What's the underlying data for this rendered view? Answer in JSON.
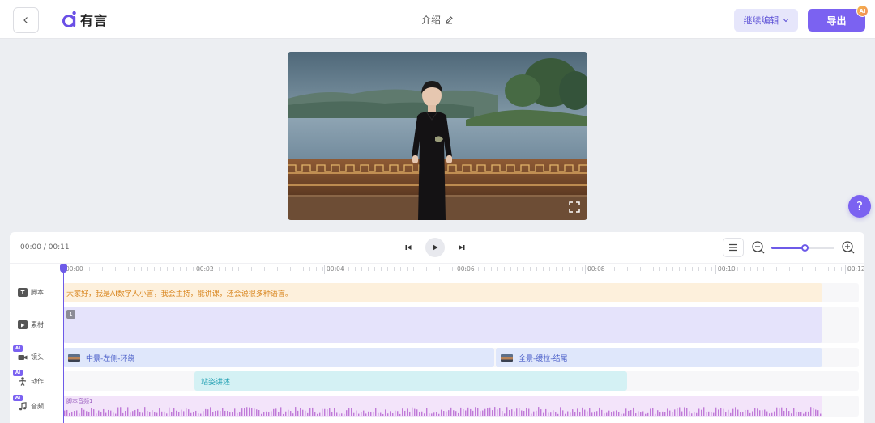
{
  "header": {
    "back_icon": "chevron-left-icon",
    "logo_name": "有言",
    "doc_title": "介绍",
    "continue_label": "继续编辑",
    "export_label": "导出",
    "export_badge": "AI"
  },
  "help": {
    "label": "?"
  },
  "player": {
    "time": "00:00 / 00:11"
  },
  "zoom": {
    "level": 0.52
  },
  "ruler": {
    "ticks": [
      "00:00",
      "00:02",
      "00:04",
      "00:06",
      "00:08",
      "00:10",
      "00:12"
    ]
  },
  "tracks": {
    "script": {
      "label": "脚本",
      "icon": "T",
      "text": "大家好，我是AI数字人小言，我会主持，能讲课，还会说很多种语言。"
    },
    "material": {
      "label": "素材",
      "badge": "1"
    },
    "camera": {
      "label": "镜头",
      "ai_tag": "AI",
      "clip1": "中景-左侧-环绕",
      "clip2": "全景-缓拉-结尾"
    },
    "action": {
      "label": "动作",
      "ai_tag": "AI",
      "clip": "站姿讲述"
    },
    "audio": {
      "label": "音频",
      "ai_tag": "AI",
      "clip": "脚本音频1"
    }
  },
  "colors": {
    "accent": "#7b62f1",
    "script": "#fdf0dc",
    "camera": "#dfe7fb",
    "action": "#d4f1f4",
    "audio": "#f3e4fa"
  }
}
